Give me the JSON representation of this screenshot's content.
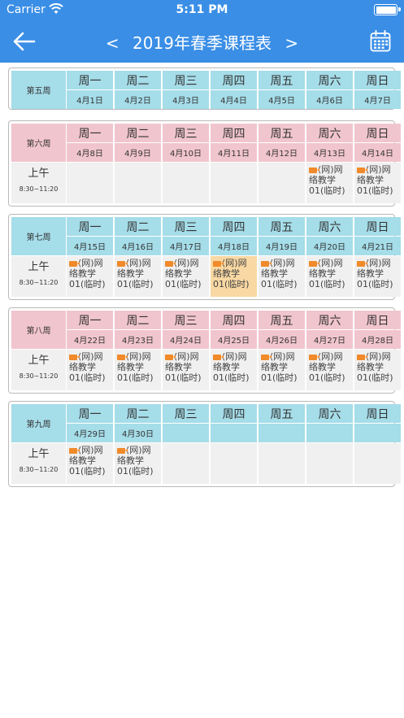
{
  "status": {
    "carrier": "Carrier",
    "time": "5:11 PM"
  },
  "nav": {
    "prev_arrow": "<",
    "title": "2019年春季课程表",
    "next_arrow": ">"
  },
  "day_names": [
    "周一",
    "周二",
    "周三",
    "周四",
    "周五",
    "周六",
    "周日"
  ],
  "period": {
    "label": "上午",
    "time": "8:30~11:20"
  },
  "course": {
    "line1": "(网)网",
    "line2": "络教学",
    "line3": "01(临时)"
  },
  "colors": {
    "header": "#3a8ee6",
    "blue": "#a5dde9",
    "pink": "#f1c5ce",
    "highlight": "#f9d8a3",
    "video": "#f08a2a"
  },
  "weeks": [
    {
      "label": "第五周",
      "theme": "blue",
      "has_period": false,
      "dates": [
        "4月1日",
        "4月2日",
        "4月3日",
        "4月4日",
        "4月5日",
        "4月6日",
        "4月7日"
      ],
      "courses": [
        false,
        false,
        false,
        false,
        false,
        false,
        false
      ],
      "highlight": []
    },
    {
      "label": "第六周",
      "theme": "pink",
      "has_period": true,
      "dates": [
        "4月8日",
        "4月9日",
        "4月10日",
        "4月11日",
        "4月12日",
        "4月13日",
        "4月14日"
      ],
      "courses": [
        false,
        false,
        false,
        false,
        false,
        true,
        true
      ],
      "highlight": []
    },
    {
      "label": "第七周",
      "theme": "blue",
      "has_period": true,
      "dates": [
        "4月15日",
        "4月16日",
        "4月17日",
        "4月18日",
        "4月19日",
        "4月20日",
        "4月21日"
      ],
      "courses": [
        true,
        true,
        true,
        true,
        true,
        true,
        true
      ],
      "highlight": [
        3
      ]
    },
    {
      "label": "第八周",
      "theme": "pink",
      "has_period": true,
      "dates": [
        "4月22日",
        "4月23日",
        "4月24日",
        "4月25日",
        "4月26日",
        "4月27日",
        "4月28日"
      ],
      "courses": [
        true,
        true,
        true,
        true,
        true,
        true,
        true
      ],
      "highlight": []
    },
    {
      "label": "第九周",
      "theme": "blue",
      "has_period": true,
      "dates": [
        "4月29日",
        "4月30日",
        "",
        "",
        "",
        "",
        ""
      ],
      "courses": [
        true,
        true,
        false,
        false,
        false,
        false,
        false
      ],
      "highlight": []
    }
  ]
}
